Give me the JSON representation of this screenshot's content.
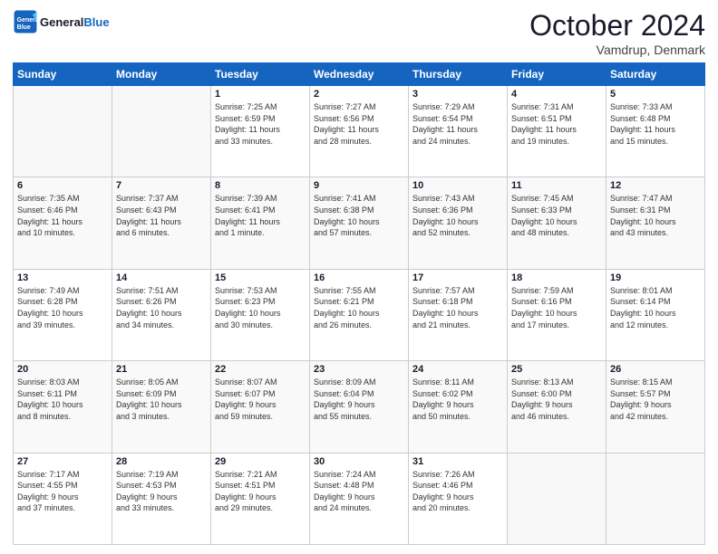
{
  "header": {
    "logo_line1": "General",
    "logo_line2": "Blue",
    "month": "October 2024",
    "location": "Vamdrup, Denmark"
  },
  "weekdays": [
    "Sunday",
    "Monday",
    "Tuesday",
    "Wednesday",
    "Thursday",
    "Friday",
    "Saturday"
  ],
  "weeks": [
    [
      {
        "day": "",
        "info": ""
      },
      {
        "day": "",
        "info": ""
      },
      {
        "day": "1",
        "info": "Sunrise: 7:25 AM\nSunset: 6:59 PM\nDaylight: 11 hours\nand 33 minutes."
      },
      {
        "day": "2",
        "info": "Sunrise: 7:27 AM\nSunset: 6:56 PM\nDaylight: 11 hours\nand 28 minutes."
      },
      {
        "day": "3",
        "info": "Sunrise: 7:29 AM\nSunset: 6:54 PM\nDaylight: 11 hours\nand 24 minutes."
      },
      {
        "day": "4",
        "info": "Sunrise: 7:31 AM\nSunset: 6:51 PM\nDaylight: 11 hours\nand 19 minutes."
      },
      {
        "day": "5",
        "info": "Sunrise: 7:33 AM\nSunset: 6:48 PM\nDaylight: 11 hours\nand 15 minutes."
      }
    ],
    [
      {
        "day": "6",
        "info": "Sunrise: 7:35 AM\nSunset: 6:46 PM\nDaylight: 11 hours\nand 10 minutes."
      },
      {
        "day": "7",
        "info": "Sunrise: 7:37 AM\nSunset: 6:43 PM\nDaylight: 11 hours\nand 6 minutes."
      },
      {
        "day": "8",
        "info": "Sunrise: 7:39 AM\nSunset: 6:41 PM\nDaylight: 11 hours\nand 1 minute."
      },
      {
        "day": "9",
        "info": "Sunrise: 7:41 AM\nSunset: 6:38 PM\nDaylight: 10 hours\nand 57 minutes."
      },
      {
        "day": "10",
        "info": "Sunrise: 7:43 AM\nSunset: 6:36 PM\nDaylight: 10 hours\nand 52 minutes."
      },
      {
        "day": "11",
        "info": "Sunrise: 7:45 AM\nSunset: 6:33 PM\nDaylight: 10 hours\nand 48 minutes."
      },
      {
        "day": "12",
        "info": "Sunrise: 7:47 AM\nSunset: 6:31 PM\nDaylight: 10 hours\nand 43 minutes."
      }
    ],
    [
      {
        "day": "13",
        "info": "Sunrise: 7:49 AM\nSunset: 6:28 PM\nDaylight: 10 hours\nand 39 minutes."
      },
      {
        "day": "14",
        "info": "Sunrise: 7:51 AM\nSunset: 6:26 PM\nDaylight: 10 hours\nand 34 minutes."
      },
      {
        "day": "15",
        "info": "Sunrise: 7:53 AM\nSunset: 6:23 PM\nDaylight: 10 hours\nand 30 minutes."
      },
      {
        "day": "16",
        "info": "Sunrise: 7:55 AM\nSunset: 6:21 PM\nDaylight: 10 hours\nand 26 minutes."
      },
      {
        "day": "17",
        "info": "Sunrise: 7:57 AM\nSunset: 6:18 PM\nDaylight: 10 hours\nand 21 minutes."
      },
      {
        "day": "18",
        "info": "Sunrise: 7:59 AM\nSunset: 6:16 PM\nDaylight: 10 hours\nand 17 minutes."
      },
      {
        "day": "19",
        "info": "Sunrise: 8:01 AM\nSunset: 6:14 PM\nDaylight: 10 hours\nand 12 minutes."
      }
    ],
    [
      {
        "day": "20",
        "info": "Sunrise: 8:03 AM\nSunset: 6:11 PM\nDaylight: 10 hours\nand 8 minutes."
      },
      {
        "day": "21",
        "info": "Sunrise: 8:05 AM\nSunset: 6:09 PM\nDaylight: 10 hours\nand 3 minutes."
      },
      {
        "day": "22",
        "info": "Sunrise: 8:07 AM\nSunset: 6:07 PM\nDaylight: 9 hours\nand 59 minutes."
      },
      {
        "day": "23",
        "info": "Sunrise: 8:09 AM\nSunset: 6:04 PM\nDaylight: 9 hours\nand 55 minutes."
      },
      {
        "day": "24",
        "info": "Sunrise: 8:11 AM\nSunset: 6:02 PM\nDaylight: 9 hours\nand 50 minutes."
      },
      {
        "day": "25",
        "info": "Sunrise: 8:13 AM\nSunset: 6:00 PM\nDaylight: 9 hours\nand 46 minutes."
      },
      {
        "day": "26",
        "info": "Sunrise: 8:15 AM\nSunset: 5:57 PM\nDaylight: 9 hours\nand 42 minutes."
      }
    ],
    [
      {
        "day": "27",
        "info": "Sunrise: 7:17 AM\nSunset: 4:55 PM\nDaylight: 9 hours\nand 37 minutes."
      },
      {
        "day": "28",
        "info": "Sunrise: 7:19 AM\nSunset: 4:53 PM\nDaylight: 9 hours\nand 33 minutes."
      },
      {
        "day": "29",
        "info": "Sunrise: 7:21 AM\nSunset: 4:51 PM\nDaylight: 9 hours\nand 29 minutes."
      },
      {
        "day": "30",
        "info": "Sunrise: 7:24 AM\nSunset: 4:48 PM\nDaylight: 9 hours\nand 24 minutes."
      },
      {
        "day": "31",
        "info": "Sunrise: 7:26 AM\nSunset: 4:46 PM\nDaylight: 9 hours\nand 20 minutes."
      },
      {
        "day": "",
        "info": ""
      },
      {
        "day": "",
        "info": ""
      }
    ]
  ]
}
